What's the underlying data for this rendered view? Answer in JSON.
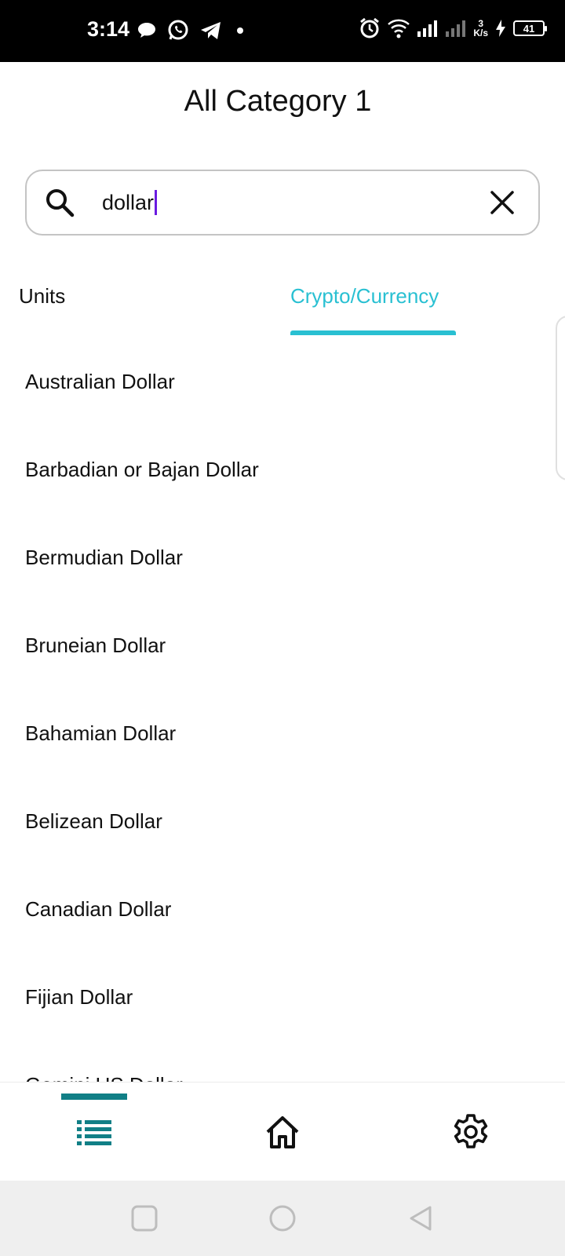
{
  "status_bar": {
    "time": "3:14",
    "speed_value": "3",
    "speed_unit": "K/s",
    "battery": "41"
  },
  "header": {
    "title": "All Category 1"
  },
  "search": {
    "value": "dollar"
  },
  "tabs": [
    {
      "label": "Units",
      "active": false
    },
    {
      "label": "Crypto/Currency",
      "active": true
    }
  ],
  "colors": {
    "accent": "#29c0d2",
    "nav_active": "#117f86",
    "caret": "#6a1be0"
  },
  "currencies": [
    "Australian Dollar",
    "Barbadian or Bajan Dollar",
    "Bermudian Dollar",
    "Bruneian Dollar",
    "Bahamian Dollar",
    "Belizean Dollar",
    "Canadian Dollar",
    "Fijian Dollar",
    "Gemini US Dollar"
  ],
  "bottom_nav": [
    {
      "icon": "list-icon",
      "active": true
    },
    {
      "icon": "home-icon",
      "active": false
    },
    {
      "icon": "gear-icon",
      "active": false
    }
  ],
  "system_nav": [
    "recents-icon",
    "home-circle-icon",
    "back-icon"
  ]
}
